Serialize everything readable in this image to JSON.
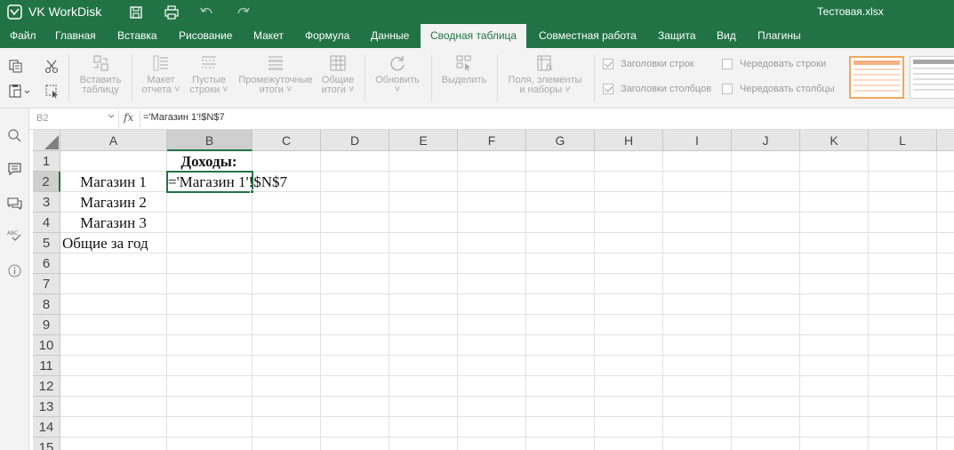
{
  "app": {
    "name": "VK WorkDisk",
    "document_title": "Тестовая.xlsx",
    "brand_color": "#217346"
  },
  "menu": {
    "tabs": [
      {
        "label": "Файл"
      },
      {
        "label": "Главная"
      },
      {
        "label": "Вставка"
      },
      {
        "label": "Рисование"
      },
      {
        "label": "Макет"
      },
      {
        "label": "Формула"
      },
      {
        "label": "Данные"
      },
      {
        "label": "Сводная таблица",
        "active": true
      },
      {
        "label": "Совместная работа"
      },
      {
        "label": "Защита"
      },
      {
        "label": "Вид"
      },
      {
        "label": "Плагины"
      }
    ]
  },
  "ribbon": {
    "insert_table": [
      "Вставить",
      "таблицу"
    ],
    "report_layout": [
      "Макет",
      "отчета ˅"
    ],
    "blank_rows": [
      "Пустые",
      "строки ˅"
    ],
    "subtotals": [
      "Промежуточные",
      "итоги ˅"
    ],
    "grand_totals": [
      "Общие",
      "итоги ˅"
    ],
    "refresh": [
      "Обновить",
      "˅"
    ],
    "select": [
      "Выделить"
    ],
    "field_list": [
      "Поля, элементы",
      "и наборы ˅"
    ],
    "row_headers": {
      "label": "Заголовки строк",
      "checked": true
    },
    "column_headers": {
      "label": "Заголовки столбцов",
      "checked": true
    },
    "banded_rows": {
      "label": "Чередовать строки",
      "checked": false
    },
    "banded_columns": {
      "label": "Чередовать столбцы",
      "checked": false
    }
  },
  "formula_bar": {
    "cell_ref": "B2",
    "fx": "fx",
    "formula": "='Магазин 1'!$N$7"
  },
  "sheet": {
    "columns": [
      "A",
      "B",
      "C",
      "D",
      "E",
      "F",
      "G",
      "H",
      "I",
      "J",
      "K",
      "L"
    ],
    "rows": [
      "1",
      "2",
      "3",
      "4",
      "5",
      "6",
      "7",
      "8",
      "9",
      "10",
      "11",
      "12",
      "13",
      "14",
      "15"
    ],
    "selected_column": "B",
    "selected_row": "2",
    "cells": {
      "B1": "Доходы:",
      "A2": "Магазин 1",
      "B2": "='Магазин 1'!$N$7",
      "A3": "Магазин 2",
      "A4": "Магазин 3",
      "A5": "Общие за год"
    }
  }
}
